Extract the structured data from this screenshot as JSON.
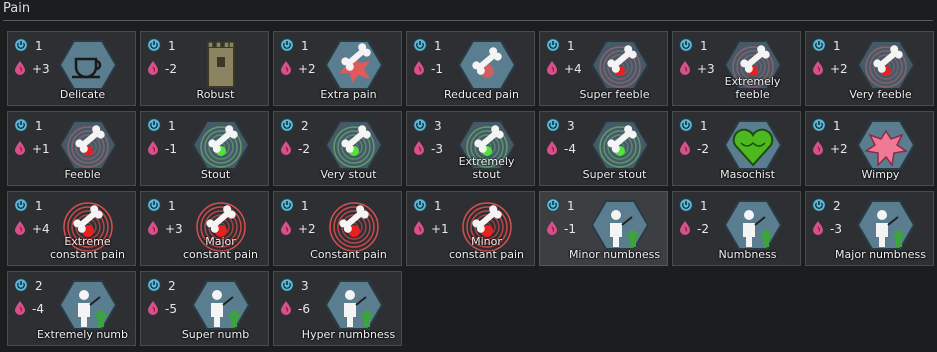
{
  "section": {
    "title": "Pain"
  },
  "colors": {
    "card_bg": "#2e2f33",
    "cost_icon": "#5fb8d8",
    "pain_icon": "#d94f8c",
    "hex_fill": "#5b7d90"
  },
  "icons": {
    "cost": "power-cost-icon",
    "pain": "pain-drop-icon"
  },
  "traits": [
    {
      "name": "Delicate",
      "cost": "1",
      "pain": "+3",
      "icon": "teacup-icon",
      "disabled": false
    },
    {
      "name": "Robust",
      "cost": "1",
      "pain": "-2",
      "icon": "tower-icon",
      "disabled": false
    },
    {
      "name": "Extra pain",
      "cost": "1",
      "pain": "+2",
      "icon": "bone-burst-icon",
      "disabled": false
    },
    {
      "name": "Reduced pain",
      "cost": "1",
      "pain": "-1",
      "icon": "bone-icon",
      "disabled": false
    },
    {
      "name": "Super feeble",
      "cost": "1",
      "pain": "+4",
      "icon": "bone-red-rings-icon",
      "disabled": false
    },
    {
      "name": "Extremely feeble",
      "cost": "1",
      "pain": "+3",
      "icon": "bone-red-rings-icon",
      "disabled": false
    },
    {
      "name": "Very feeble",
      "cost": "1",
      "pain": "+2",
      "icon": "bone-red-rings-icon",
      "disabled": false
    },
    {
      "name": "Feeble",
      "cost": "1",
      "pain": "+1",
      "icon": "bone-red-rings-icon",
      "disabled": false
    },
    {
      "name": "Stout",
      "cost": "1",
      "pain": "-1",
      "icon": "bone-green-rings-icon",
      "disabled": false
    },
    {
      "name": "Very stout",
      "cost": "2",
      "pain": "-2",
      "icon": "bone-green-rings-icon",
      "disabled": false
    },
    {
      "name": "Extremely stout",
      "cost": "3",
      "pain": "-3",
      "icon": "bone-green-rings-icon",
      "disabled": false
    },
    {
      "name": "Super stout",
      "cost": "3",
      "pain": "-4",
      "icon": "bone-green-rings-icon",
      "disabled": false
    },
    {
      "name": "Masochist",
      "cost": "1",
      "pain": "-2",
      "icon": "green-heart-icon",
      "disabled": false
    },
    {
      "name": "Wimpy",
      "cost": "1",
      "pain": "+2",
      "icon": "pink-burst-icon",
      "disabled": false
    },
    {
      "name": "Extreme constant pain",
      "cost": "1",
      "pain": "+4",
      "icon": "bone-pain-rings-icon",
      "disabled": false
    },
    {
      "name": "Major constant pain",
      "cost": "1",
      "pain": "+3",
      "icon": "bone-pain-rings-icon",
      "disabled": false
    },
    {
      "name": "Constant pain",
      "cost": "1",
      "pain": "+2",
      "icon": "bone-pain-rings-icon",
      "disabled": false
    },
    {
      "name": "Minor constant pain",
      "cost": "1",
      "pain": "+1",
      "icon": "bone-pain-rings-icon",
      "disabled": false
    },
    {
      "name": "Minor numbness",
      "cost": "1",
      "pain": "-1",
      "icon": "numb-figure-icon",
      "disabled": true
    },
    {
      "name": "Numbness",
      "cost": "1",
      "pain": "-2",
      "icon": "numb-figure-icon",
      "disabled": false
    },
    {
      "name": "Major numbness",
      "cost": "2",
      "pain": "-3",
      "icon": "numb-figure-icon",
      "disabled": false
    },
    {
      "name": "Extremely numb",
      "cost": "2",
      "pain": "-4",
      "icon": "numb-figure-icon",
      "disabled": false
    },
    {
      "name": "Super numb",
      "cost": "2",
      "pain": "-5",
      "icon": "numb-figure-icon",
      "disabled": false
    },
    {
      "name": "Hyper numbness",
      "cost": "3",
      "pain": "-6",
      "icon": "numb-figure-icon",
      "disabled": false
    }
  ]
}
